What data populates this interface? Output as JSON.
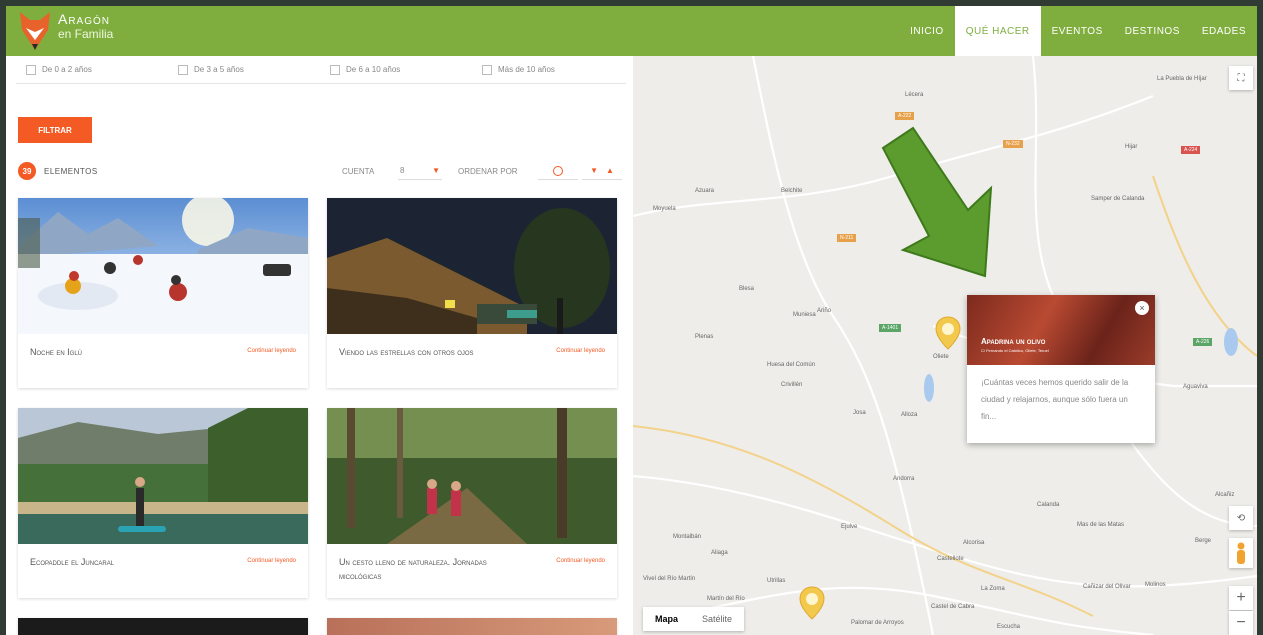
{
  "header": {
    "brand_line1": "Aragón",
    "brand_line2": "en Familia",
    "nav": [
      "Inicio",
      "Qué hacer",
      "Eventos",
      "Destinos",
      "Edades"
    ],
    "active_nav": "Qué hacer",
    "brand_color": "#7fae3e"
  },
  "filters": {
    "ages": [
      "De 0 a 2 años",
      "De 3 a 5 años",
      "De 6 a 10 años",
      "Más de 10 años"
    ],
    "filter_button": "FILTRAR",
    "count": "39",
    "count_label": "ELEMENTOS",
    "show_label": "CUENTA",
    "show_value": "8",
    "sort_label": "ORDENAR POR",
    "accent_color": "#f35a24"
  },
  "cards": [
    {
      "title": "Noche en Iglú",
      "link": "Continuar leyendo"
    },
    {
      "title": "Viendo las estrellas con otros ojos",
      "link": "Continuar leyendo"
    },
    {
      "title": "Ecopaddle el Juncaral",
      "link": "Continuar leyendo"
    },
    {
      "title": "Un cesto lleno de naturaleza. Jornadas micológicas",
      "link": "Continuar leyendo"
    }
  ],
  "map": {
    "popup_title": "Apadrina un olivo",
    "popup_address": "C/ Fernando el Católico, Oliete, Teruel",
    "popup_description": "¡Cuántas veces hemos querido salir de la ciudad y relajarnos, aunque sólo fuera un fin...",
    "map_type_map": "Mapa",
    "map_type_satellite": "Satélite",
    "towns": [
      "Lécera",
      "Muniesa",
      "Oliete",
      "Alloza",
      "Andorra",
      "Calanda",
      "Alcañiz",
      "Alcorisa",
      "Hijar",
      "Samper de Calanda",
      "La Puebla de Híjar",
      "Belchite",
      "Azuara",
      "Moyuela",
      "Plenas",
      "Blesa",
      "Huesa del Común",
      "Josa",
      "Ariño",
      "Crivillén",
      "Ejulve",
      "Aguaviva",
      "Mas de las Matas",
      "Berge",
      "Molinos",
      "Castellote",
      "Utrillas",
      "Montalbán",
      "Aliaga",
      "La Zoma",
      "Cañizar del Olivar",
      "Castel de Cabra",
      "Palomar de Arroyos",
      "Escucha",
      "Vivel del Río Martín",
      "Martín del Río"
    ],
    "road_labels": [
      "A-222",
      "N-232",
      "A-1401",
      "A-224",
      "N-211",
      "A-226"
    ]
  }
}
